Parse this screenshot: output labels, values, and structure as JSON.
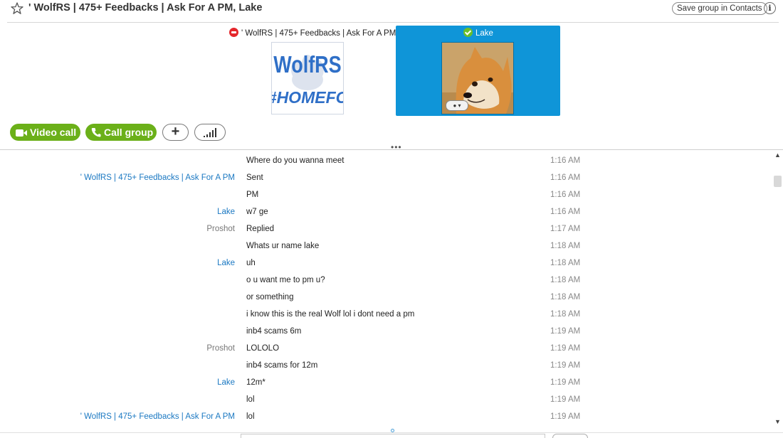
{
  "header": {
    "title": "' WolfRS | 475+ Feedbacks | Ask For A PM, Lake",
    "save_button_label": "Save group in Contacts",
    "info_button_label": "i",
    "star_icon": "star-outline-icon",
    "info_icon": "info-icon"
  },
  "participants": [
    {
      "name": "' WolfRS | 475+ Feedbacks | Ask For A PM",
      "status": "offline",
      "status_color": "#e4262b",
      "avatar_lines": [
        "WolfRS",
        "#HOMEFC"
      ]
    },
    {
      "name": "Lake",
      "status": "online",
      "status_color": "#6bbf2a",
      "selected": true,
      "avatar_menu_icon": "skype-menu-icon"
    }
  ],
  "actions": {
    "video_call_label": "Video call",
    "call_group_label": "Call group",
    "add_label": "+",
    "video_icon": "video-camera-icon",
    "phone_icon": "phone-icon",
    "signal_icon": "call-quality-icon"
  },
  "colors": {
    "accent_blue": "#0f95d8",
    "action_green": "#6bb019",
    "sender_link": "#1a78c2"
  },
  "messages": [
    {
      "sender": "",
      "text": "Where do you wanna meet",
      "time": "1:16 AM"
    },
    {
      "sender": "' WolfRS | 475+ Feedbacks | Ask For A PM",
      "text": "Sent",
      "time": "1:16 AM"
    },
    {
      "sender": "",
      "text": "PM",
      "time": "1:16 AM"
    },
    {
      "sender": "Lake",
      "text": "w7 ge",
      "time": "1:16 AM"
    },
    {
      "sender": "Proshot",
      "text": "Replied",
      "time": "1:17 AM"
    },
    {
      "sender": "",
      "text": "Whats ur name lake",
      "time": "1:18 AM"
    },
    {
      "sender": "Lake",
      "text": "uh",
      "time": "1:18 AM"
    },
    {
      "sender": "",
      "text": "o u want me to pm u?",
      "time": "1:18 AM"
    },
    {
      "sender": "",
      "text": "or something",
      "time": "1:18 AM"
    },
    {
      "sender": "",
      "text": "i know this is the real Wolf lol i dont need a pm",
      "time": "1:18 AM"
    },
    {
      "sender": "",
      "text": "inb4 scams 6m",
      "time": "1:19 AM"
    },
    {
      "sender": "Proshot",
      "text": "LOLOLO",
      "time": "1:19 AM"
    },
    {
      "sender": "",
      "text": "inb4 scams for 12m",
      "time": "1:19 AM"
    },
    {
      "sender": "Lake",
      "text": "12m*",
      "time": "1:19 AM"
    },
    {
      "sender": "",
      "text": "lol",
      "time": "1:19 AM"
    },
    {
      "sender": "' WolfRS | 475+ Feedbacks | Ask For A PM",
      "text": "lol",
      "time": "1:19 AM"
    }
  ]
}
